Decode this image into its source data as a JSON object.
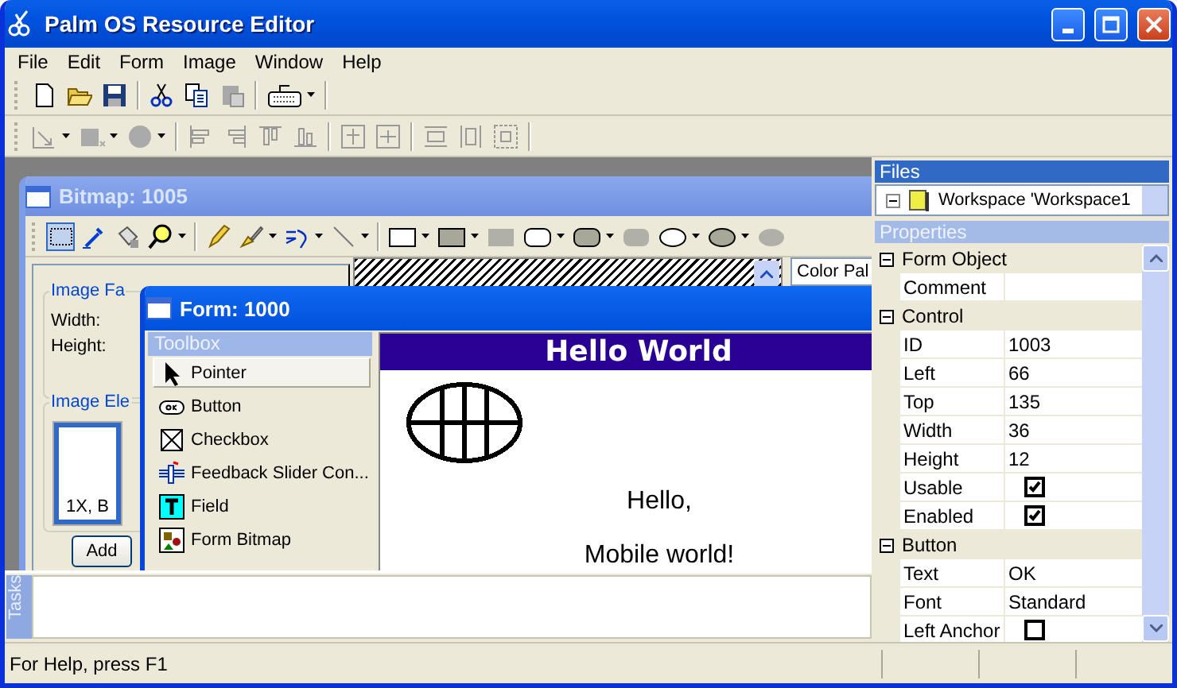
{
  "window": {
    "title": "Palm OS Resource Editor"
  },
  "menu": [
    "File",
    "Edit",
    "Form",
    "Image",
    "Window",
    "Help"
  ],
  "bitmap_window": {
    "title": "Bitmap: 1005",
    "image_family_label": "Image Fa",
    "width_label": "Width:",
    "height_label": "Height:",
    "image_elements_label": "Image Ele",
    "preview_caption": "1X, B",
    "add_button": "Add",
    "color_palette_label": "Color Pal"
  },
  "form_window": {
    "title": "Form: 1000",
    "toolbox": {
      "title": "Toolbox",
      "items": [
        {
          "label": "Pointer",
          "kind": "pointer",
          "selected": true
        },
        {
          "label": "Button",
          "kind": "button",
          "selected": false
        },
        {
          "label": "Checkbox",
          "kind": "checkbox",
          "selected": false
        },
        {
          "label": "Feedback Slider Con...",
          "kind": "slider",
          "selected": false
        },
        {
          "label": "Field",
          "kind": "field",
          "selected": false
        },
        {
          "label": "Form Bitmap",
          "kind": "bitmap",
          "selected": false
        }
      ]
    },
    "form": {
      "title": "Hello World",
      "texts": [
        "Hello,",
        "Mobile world!"
      ]
    }
  },
  "files": {
    "title": "Files",
    "items": [
      {
        "label": "Workspace 'Workspace1",
        "expanded": true
      }
    ]
  },
  "properties": {
    "title": "Properties",
    "groups": [
      {
        "name": "Form Object",
        "expanded": true,
        "rows": [
          {
            "name": "Comment",
            "kind": "text"
          }
        ]
      },
      {
        "name": "Control",
        "expanded": true,
        "rows": [
          {
            "name": "ID",
            "kind": "text",
            "value": "1003"
          },
          {
            "name": "Left",
            "kind": "text",
            "value": "66"
          },
          {
            "name": "Top",
            "kind": "text",
            "value": "135"
          },
          {
            "name": "Width",
            "kind": "text",
            "value": "36"
          },
          {
            "name": "Height",
            "kind": "text",
            "value": "12"
          },
          {
            "name": "Usable",
            "kind": "checkbox",
            "checked": true
          },
          {
            "name": "Enabled",
            "kind": "checkbox",
            "checked": true
          }
        ]
      },
      {
        "name": "Button",
        "expanded": true,
        "rows": [
          {
            "name": "Text",
            "kind": "text",
            "value": "OK"
          },
          {
            "name": "Font",
            "kind": "text",
            "value": "Standard"
          },
          {
            "name": "Left Anchor",
            "kind": "checkbox",
            "checked": false
          }
        ]
      }
    ]
  },
  "tasks": {
    "title": "Tasks"
  },
  "status_bar": "For Help, press F1"
}
